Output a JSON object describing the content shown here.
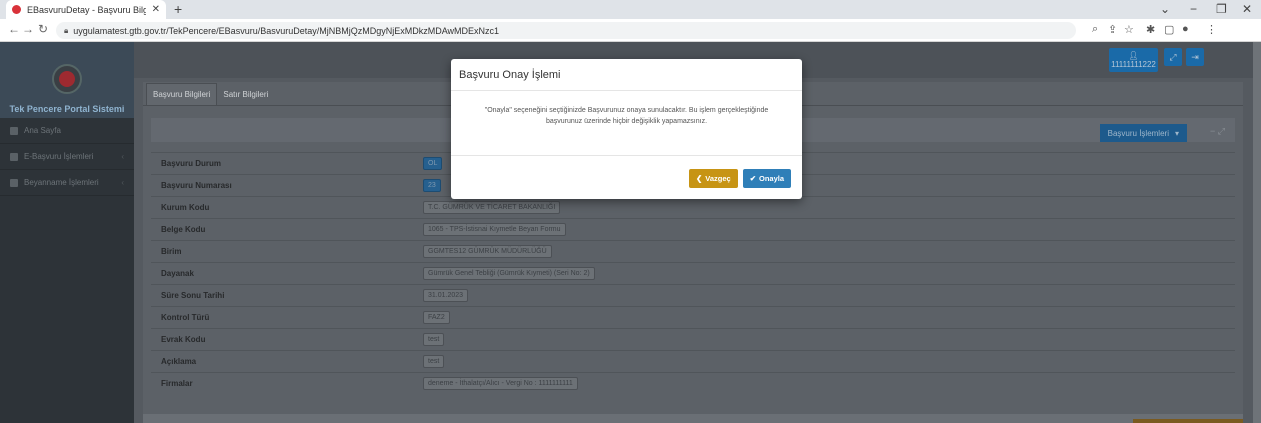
{
  "browser": {
    "tab_title": "EBasvuruDetay - Başvuru Bilgi Sü",
    "tab_close": "✕",
    "new_tab": "+",
    "url": "uygulamatest.gtb.gov.tr/TekPencere/EBasvuru/BasvuruDetay/MjNBMjQzMDgyNjExMDkzMDAwMDExNzc1"
  },
  "sidebar": {
    "portal_name": "Tek Pencere Portal Sistemi",
    "items": [
      {
        "label": "Ana Sayfa"
      },
      {
        "label": "E-Başvuru İşlemleri"
      },
      {
        "label": "Beyanname İşlemleri"
      }
    ]
  },
  "topbar": {
    "user_id": "11111111222"
  },
  "content": {
    "tabs": [
      "Başvuru Bilgileri",
      "Satır Bilgileri"
    ],
    "actions_button": "Başvuru İşlemleri",
    "rows": [
      {
        "key": "Başvuru Durum",
        "value": "OL"
      },
      {
        "key": "Başvuru Numarası",
        "value": "23"
      },
      {
        "key": "Kurum Kodu",
        "value": "T.C. GÜMRÜK VE TİCARET BAKANLIĞI"
      },
      {
        "key": "Belge Kodu",
        "value": "1065 - TPS-İstisnai Kıymetle Beyan Formu"
      },
      {
        "key": "Birim",
        "value": "GGMTES12 GÜMRÜK MÜDÜRLÜĞÜ"
      },
      {
        "key": "Dayanak",
        "value": "Gümrük Genel Tebliği (Gümrük Kıymeti) (Seri No: 2)"
      },
      {
        "key": "Süre Sonu Tarihi",
        "value": "31.01.2023"
      },
      {
        "key": "Kontrol Türü",
        "value": "FAZ2"
      },
      {
        "key": "Evrak Kodu",
        "value": "test"
      },
      {
        "key": "Açıklama",
        "value": "test"
      },
      {
        "key": "Firmalar",
        "value": "deneme - İthalatçı/Alıcı - Vergi No : 1111111111"
      }
    ]
  },
  "modal": {
    "title": "Başvuru Onay İşlemi",
    "message": "\"Onayla\" seçeneğini seçtiğinizde Başvurunuz onaya sunulacaktır. Bu işlem gerçekleştiğinde başvurunuz üzerinde hiçbir değişiklik yapamazsınız.",
    "cancel_label": "Vazgeç",
    "confirm_label": "Onayla"
  },
  "colors": {
    "confirm": "#2f7fb8",
    "cancel": "#c79414"
  }
}
